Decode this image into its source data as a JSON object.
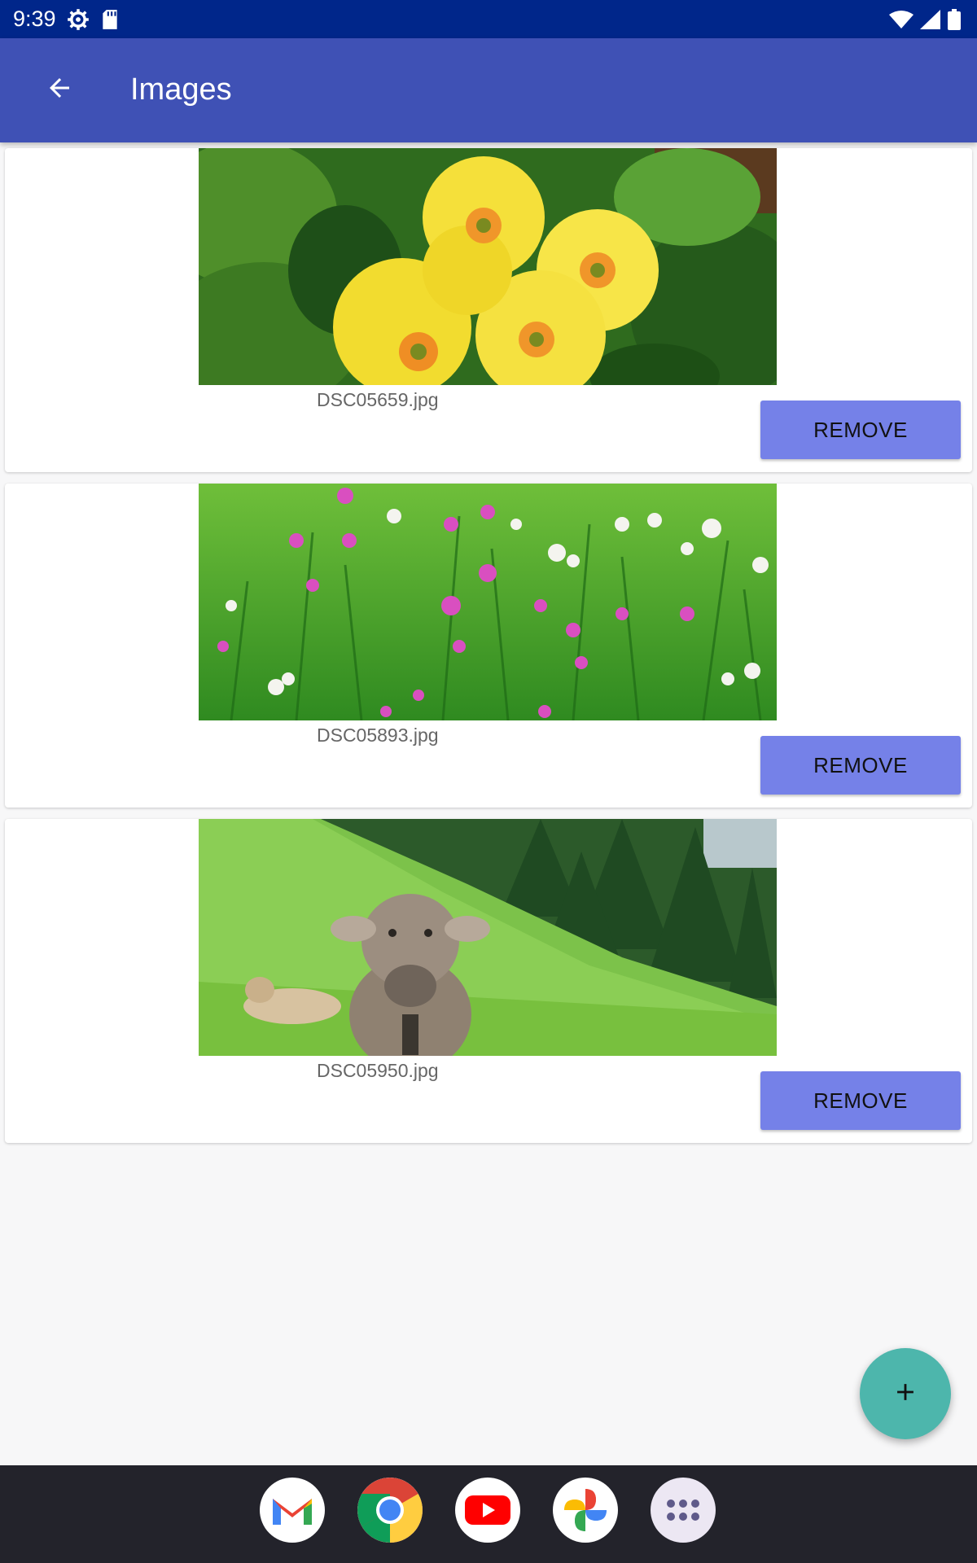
{
  "status_bar": {
    "time": "9:39",
    "icons": [
      "settings-gear-icon",
      "sd-card-icon",
      "wifi-icon",
      "cell-signal-icon",
      "battery-icon"
    ]
  },
  "app_bar": {
    "title": "Images",
    "back_icon": "arrow-back-icon"
  },
  "images": [
    {
      "filename": "DSC05659.jpg",
      "remove_label": "REMOVE",
      "subject": "yellow-primrose-photo"
    },
    {
      "filename": "DSC05893.jpg",
      "remove_label": "REMOVE",
      "subject": "meadow-wildflowers-photo"
    },
    {
      "filename": "DSC05950.jpg",
      "remove_label": "REMOVE",
      "subject": "cow-on-hillside-photo"
    }
  ],
  "fab": {
    "icon": "plus-icon"
  },
  "dock": [
    "gmail-icon",
    "chrome-icon",
    "youtube-icon",
    "photos-icon",
    "app-drawer-icon"
  ],
  "colors": {
    "status_bar": "#00268a",
    "app_bar": "#3f51b5",
    "remove_button": "#7581e8",
    "fab": "#4db6ac",
    "nav_bar": "#23232b"
  }
}
